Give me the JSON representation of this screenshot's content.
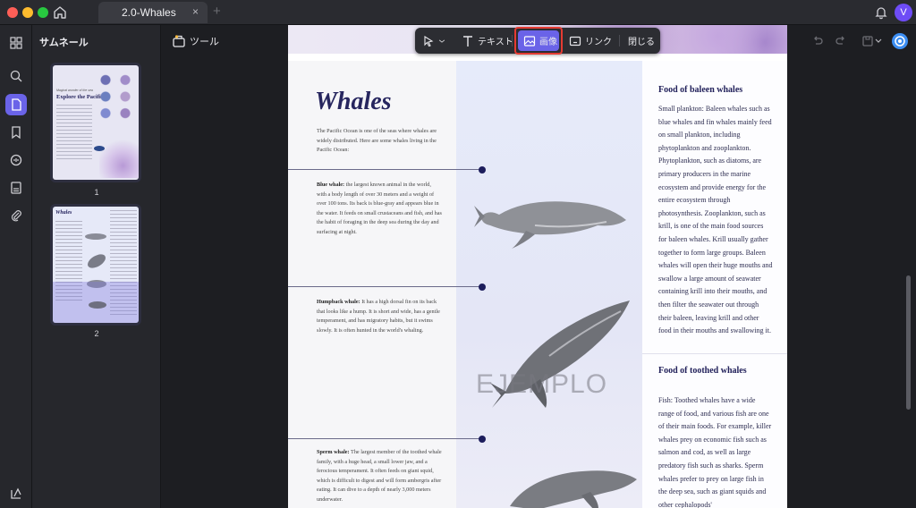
{
  "window": {
    "tab_title": "2.0-Whales",
    "tab_close": "×",
    "tab_add": "+",
    "avatar_initial": "V"
  },
  "sidebar": {
    "title": "サムネール",
    "pages": [
      {
        "number": "1",
        "thumb_heading": "Explore the Pacific",
        "thumb_kicker": "Magical wonder of the sea"
      },
      {
        "number": "2",
        "thumb_heading": "Whales"
      }
    ]
  },
  "rail": {
    "items": [
      "grid-icon",
      "search-icon",
      "page-icon",
      "bookmark-icon",
      "comment-icon",
      "form-icon",
      "attachment-icon"
    ],
    "bottom": "layers-icon"
  },
  "toolbar": {
    "tool_label": "ツール",
    "edit": {
      "select": "",
      "text": "テキスト",
      "image": "画像",
      "link": "リンク",
      "close": "閉じる"
    }
  },
  "document": {
    "title": "Whales",
    "intro": "The Pacific Ocean is one of the seas where whales are widely distributed. Here are some whales living in the Pacific Ocean:",
    "entries": [
      {
        "name": "Blue whale:",
        "text": " the largest known animal in the world, with a body length of over 30 meters and a weight of over 100 tons. Its back is blue-gray and appears blue in the water. It feeds on small crustaceans and fish, and has the habit of foraging in the deep sea during the day and surfacing at night."
      },
      {
        "name": "Humpback whale:",
        "text": " It has a high dorsal fin on its back that looks like a hump. It is short and wide, has a gentle temperament, and has migratory habits, but it swims slowly. It is often hunted in the world's whaling."
      },
      {
        "name": "Sperm whale:",
        "text": " The largest member of the toothed whale family, with a huge head, a small lower jaw, and a ferocious temperament. It often feeds on giant squid, which is difficult to digest and will form ambergris after eating. It can dive to a depth of nearly 3,000 meters underwater."
      }
    ],
    "watermark": "EJEMPLO",
    "sections": [
      {
        "heading": "Food of baleen whales",
        "body": "Small plankton: Baleen whales such as blue whales and fin whales mainly feed on small plankton, including phytoplankton and zooplankton. Phytoplankton, such as diatoms, are primary producers in the marine ecosystem and provide energy for the entire ecosystem through photosynthesis. Zooplankton, such as krill, is one of the main food sources for baleen whales. Krill usually gather together to form large groups. Baleen whales will open their huge mouths and swallow a large amount of seawater containing krill into their mouths, and then filter the seawater out through their baleen, leaving krill and other food in their mouths and swallowing it."
      },
      {
        "heading": "Food of toothed whales",
        "body": "Fish: Toothed whales have a wide range of food, and various fish are one of their main foods. For example, killer whales prey on economic fish such as salmon and cod, as well as large predatory fish such as sharks. Sperm whales prefer to prey on large fish in the deep sea, such as giant squids and other cephalopods'"
      }
    ]
  },
  "colors": {
    "accent": "#6a63e8",
    "highlight": "#e53b32",
    "title_navy": "#27265f"
  }
}
